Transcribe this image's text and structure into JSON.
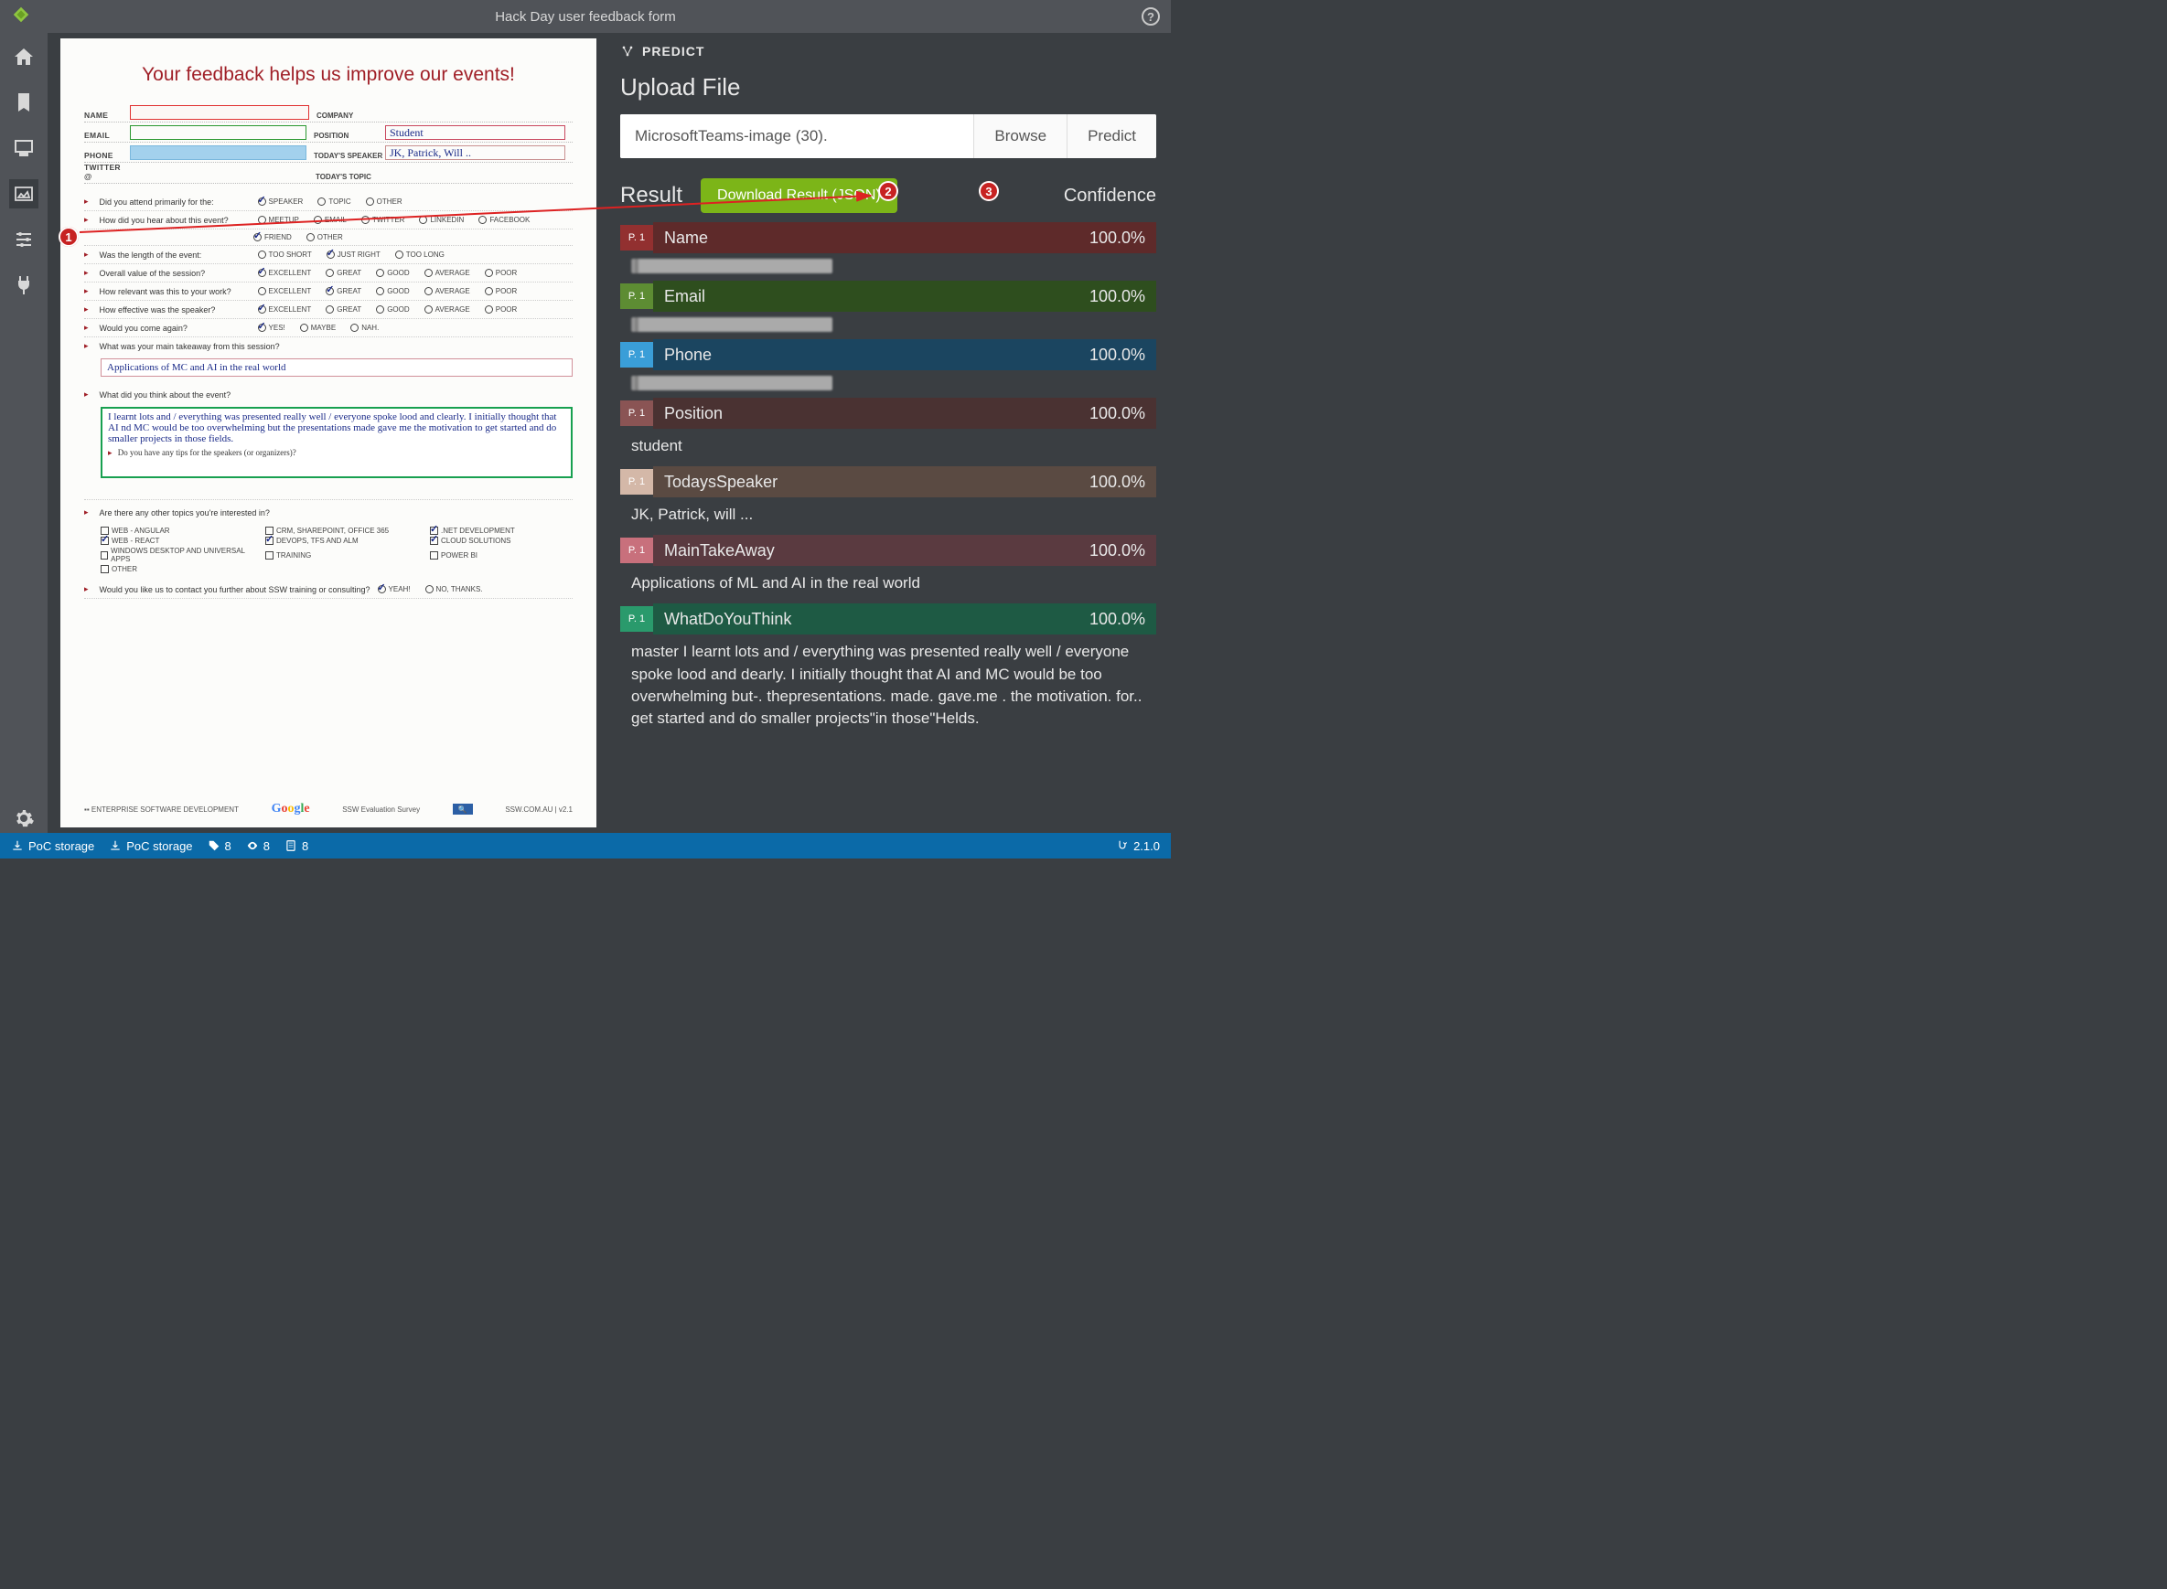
{
  "app": {
    "title": "Hack Day user feedback form"
  },
  "sidebar": {
    "items": [
      "home",
      "bookmark",
      "monitor",
      "image-area",
      "sliders",
      "plug"
    ]
  },
  "document": {
    "title": "Your feedback helps us improve our events!",
    "fields": {
      "name": "NAME",
      "company": "COMPANY",
      "email": "EMAIL",
      "position": "POSITION",
      "position_value": "Student",
      "phone": "PHONE",
      "todays_speaker": "TODAY'S SPEAKER",
      "todays_speaker_value": "JK, Patrick, Will ..",
      "twitter": "TWITTER @",
      "todays_topic": "TODAY'S TOPIC"
    },
    "questions": [
      "Did you attend primarily for the:",
      "How did you hear about this event?",
      "Was the length of the event:",
      "Overall value of the session?",
      "How relevant was this to your work?",
      "How effective was the speaker?",
      "Would you come again?",
      "What was your main takeaway from this session?",
      "What did you think about the event?",
      "Do you have any tips for the speakers (or organizers)?",
      "Are there any other topics you're interested in?",
      "Would you like us to contact you further about SSW training or consulting?"
    ],
    "opts": {
      "attend": [
        "SPEAKER",
        "TOPIC",
        "OTHER"
      ],
      "hear": [
        "MEETUP",
        "EMAIL",
        "TWITTER",
        "LINKEDIN",
        "FACEBOOK",
        "FRIEND",
        "OTHER"
      ],
      "length": [
        "TOO SHORT",
        "JUST RIGHT",
        "TOO LONG"
      ],
      "rating": [
        "EXCELLENT",
        "GREAT",
        "GOOD",
        "AVERAGE",
        "POOR"
      ],
      "again": [
        "YES!",
        "MAYBE",
        "NAH."
      ],
      "contact": [
        "YEAH!",
        "NO, THANKS."
      ],
      "topics": [
        "WEB - ANGULAR",
        "CRM, SHAREPOINT, OFFICE 365",
        ".NET DEVELOPMENT",
        "WEB - REACT",
        "DEVOPS, TFS AND ALM",
        "CLOUD SOLUTIONS",
        "WINDOWS DESKTOP AND UNIVERSAL APPS",
        "TRAINING",
        "POWER BI",
        "OTHER"
      ]
    },
    "takeaway_text": "Applications of MC and AI in the real world",
    "think_text": "I learnt lots and / everything was presented really well / everyone spoke lood and clearly. I initially thought that AI nd MC would be too overwhelming but the presentations made gave me the motivation to get started and do smaller projects in those fields.",
    "footer": {
      "enterprise": "ENTERPRISE SOFTWARE DEVELOPMENT",
      "google": "Google",
      "survey": "SSW Evaluation Survey",
      "url": "SSW.COM.AU | v2.1"
    }
  },
  "predict": {
    "header": "PREDICT",
    "upload_title": "Upload File",
    "filename": "MicrosoftTeams-image (30).",
    "browse": "Browse",
    "predict_btn": "Predict",
    "result_title": "Result",
    "download": "Download Result (JSON)",
    "confidence": "Confidence",
    "page_prefix": "P. 1",
    "results": [
      {
        "label": "Name",
        "conf": "100.0%",
        "page_bg": "#923030",
        "bar_bg": "#5e2a2a",
        "value": "",
        "redacted": true
      },
      {
        "label": "Email",
        "conf": "100.0%",
        "page_bg": "#5d8c33",
        "bar_bg": "#2e4e1e",
        "value": "",
        "redacted": true
      },
      {
        "label": "Phone",
        "conf": "100.0%",
        "page_bg": "#3a9ed8",
        "bar_bg": "#1b4560",
        "value": "",
        "redacted": true
      },
      {
        "label": "Position",
        "conf": "100.0%",
        "page_bg": "#8a5454",
        "bar_bg": "#4a3232",
        "value": "student"
      },
      {
        "label": "TodaysSpeaker",
        "conf": "100.0%",
        "page_bg": "#d4b8a8",
        "bar_bg": "#5a4a42",
        "value": "JK, Patrick, will ..."
      },
      {
        "label": "MainTakeAway",
        "conf": "100.0%",
        "page_bg": "#c8707c",
        "bar_bg": "#5a3a40",
        "value": "Applications of ML and AI in the real world"
      },
      {
        "label": "WhatDoYouThink",
        "conf": "100.0%",
        "page_bg": "#2a9a6c",
        "bar_bg": "#1e5a44",
        "value": "master I learnt lots and / everything was presented really well / everyone spoke lood and dearly. I initially thought that AI and MC would be too overwhelming but-. thepresentations. made. gave.me . the motivation. for.. get started and do smaller projects\"in those\"Helds."
      }
    ]
  },
  "statusbar": {
    "storage1": "PoC storage",
    "storage2": "PoC storage",
    "tags": "8",
    "views": "8",
    "assets": "8",
    "version": "2.1.0"
  },
  "callouts": [
    "1",
    "2",
    "3"
  ]
}
